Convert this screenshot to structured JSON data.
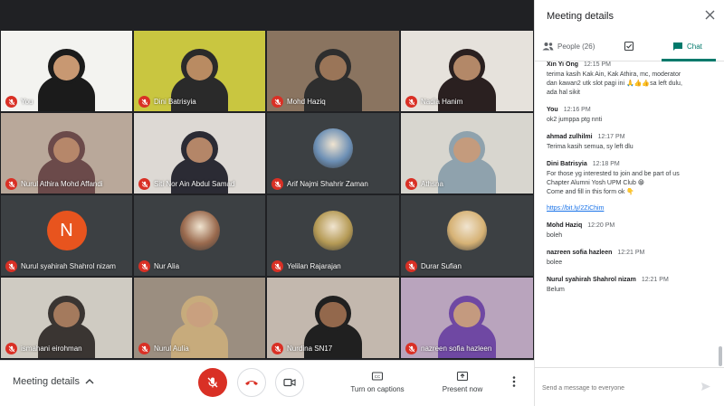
{
  "tiles": [
    {
      "name": "You",
      "bg": "#f3f3f0",
      "kind": "person",
      "skin": "#c89872",
      "hijab": "#1b1b1b",
      "muted": true
    },
    {
      "name": "Dini Batrisyia",
      "bg": "#c9c640",
      "kind": "person",
      "skin": "#b98b62",
      "hijab": "#2a2a2a",
      "muted": true
    },
    {
      "name": "Mohd Haziq",
      "bg": "#8a7460",
      "kind": "person",
      "skin": "#9a7558",
      "hijab": "#2e2e2e",
      "muted": true
    },
    {
      "name": "Nadia Hanim",
      "bg": "#e6e2dc",
      "kind": "person",
      "skin": "#b38868",
      "hijab": "#2a2020",
      "muted": true
    },
    {
      "name": "Nurul Athira Mohd Affandi",
      "bg": "#b9a89a",
      "kind": "person",
      "skin": "#b6876a",
      "hijab": "#6b4a4a",
      "muted": true
    },
    {
      "name": "Siti Nor Ain Abdul Samad",
      "bg": "#ddd9d4",
      "kind": "person",
      "skin": "#b48668",
      "hijab": "#2b2b34",
      "muted": true
    },
    {
      "name": "Arif Najmi Shahrir Zaman",
      "bg": "#3c4043",
      "kind": "avatar",
      "avatar": "#6c8fb5",
      "muted": true
    },
    {
      "name": "Athsna",
      "bg": "#d8d6cf",
      "kind": "person",
      "skin": "#c49b7d",
      "hijab": "#8fa2ad",
      "muted": true
    },
    {
      "name": "Nurul syahirah Shahrol nizam",
      "bg": "#3c4043",
      "kind": "letter",
      "letter": "N",
      "muted": true
    },
    {
      "name": "Nur Alia",
      "bg": "#3c4043",
      "kind": "avatar",
      "avatar": "#9a6a4e",
      "muted": true
    },
    {
      "name": "Yelilan Rajarajan",
      "bg": "#3c4043",
      "kind": "avatar",
      "avatar": "#b59a55",
      "muted": true
    },
    {
      "name": "Durar Sufian",
      "bg": "#3c4043",
      "kind": "avatar",
      "avatar": "#d6b275",
      "muted": true
    },
    {
      "name": "ismahani eirohman",
      "bg": "#cfcbc2",
      "kind": "person",
      "skin": "#a47a5d",
      "hijab": "#3a3532",
      "muted": true
    },
    {
      "name": "Nurul Aulia",
      "bg": "#9b8e80",
      "kind": "person",
      "skin": "#c9a07f",
      "hijab": "#c7ab7c",
      "muted": true
    },
    {
      "name": "Nurdina SN17",
      "bg": "#c3b8ae",
      "kind": "person",
      "skin": "#93684c",
      "hijab": "#202020",
      "muted": true
    },
    {
      "name": "nazreen sofia hazleen",
      "bg": "#b9a4bd",
      "kind": "person",
      "skin": "#c49a7f",
      "hijab": "#6f48a3",
      "muted": true
    }
  ],
  "bottombar": {
    "meeting_details": "Meeting details",
    "captions_label": "Turn on captions",
    "present_label": "Present now"
  },
  "panel": {
    "title": "Meeting details",
    "tabs": {
      "people": "People (26)",
      "chat": "Chat"
    },
    "messages": [
      {
        "sender": "Xin Yi Ong",
        "time": "12:15 PM",
        "lines": [
          "terima kasih Kak Ain, Kak Athira, mc, moderator",
          "dan kawan2 utk slot pagi ini 🙏👍👍sa left dulu,",
          "ada hal sikit"
        ]
      },
      {
        "sender": "You",
        "time": "12:16 PM",
        "lines": [
          "ok2 jumppa ptg nnti"
        ]
      },
      {
        "sender": "ahmad zulhilmi",
        "time": "12:17 PM",
        "lines": [
          "Terima kasih semua, sy left dlu"
        ]
      },
      {
        "sender": "Dini Batrisyia",
        "time": "12:18 PM",
        "lines": [
          "For those yg interested to join and be part of us",
          "Chapter Alumni Yosh UPM Club 😁",
          "Come and fill in this form ok 👇"
        ],
        "link": "https://bit.ly/2ZiChim"
      },
      {
        "sender": "Mohd Haziq",
        "time": "12:20 PM",
        "lines": [
          "boleh"
        ]
      },
      {
        "sender": "nazreen sofia hazleen",
        "time": "12:21 PM",
        "lines": [
          "bolee"
        ]
      },
      {
        "sender": "Nurul syahirah Shahrol nizam",
        "time": "12:21 PM",
        "lines": [
          "Belum"
        ]
      }
    ],
    "compose_placeholder": "Send a message to everyone"
  }
}
